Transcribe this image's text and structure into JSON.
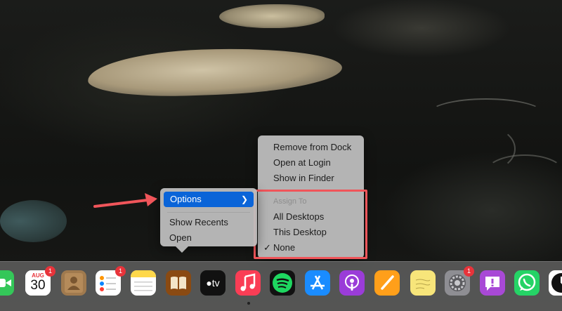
{
  "context_menu": {
    "items": [
      {
        "label": "Options"
      },
      {
        "label": "Show Recents"
      },
      {
        "label": "Open"
      }
    ],
    "highlight_color": "#0a64d8"
  },
  "options_submenu": {
    "items": [
      {
        "label": "Remove from Dock"
      },
      {
        "label": "Open at Login"
      },
      {
        "label": "Show in Finder"
      }
    ],
    "assign_to": {
      "header": "Assign To",
      "options": [
        {
          "label": "All Desktops",
          "checked": false
        },
        {
          "label": "This Desktop",
          "checked": false
        },
        {
          "label": "None",
          "checked": true
        }
      ]
    }
  },
  "annotation": {
    "box_color": "#f0555a",
    "arrow_color": "#f0555a"
  },
  "dock": {
    "apps": [
      {
        "name": "FaceTime",
        "icon": "facetime-icon"
      },
      {
        "name": "Calendar",
        "icon": "calendar-icon",
        "month": "AUG",
        "day": "30",
        "badge": "1"
      },
      {
        "name": "Contacts",
        "icon": "contacts-icon"
      },
      {
        "name": "Reminders",
        "icon": "reminders-icon",
        "badge": "1"
      },
      {
        "name": "Notes",
        "icon": "notes-icon"
      },
      {
        "name": "Books",
        "icon": "books-icon"
      },
      {
        "name": "Apple TV",
        "icon": "apple-tv-icon",
        "label": "tv"
      },
      {
        "name": "Music",
        "icon": "music-icon"
      },
      {
        "name": "Spotify",
        "icon": "spotify-icon"
      },
      {
        "name": "App Store",
        "icon": "app-store-icon"
      },
      {
        "name": "Podcasts",
        "icon": "podcasts-icon"
      },
      {
        "name": "Pages",
        "icon": "pages-icon"
      },
      {
        "name": "Stickies",
        "icon": "stickies-icon"
      },
      {
        "name": "System Preferences",
        "icon": "settings-gear-icon",
        "badge": "1"
      },
      {
        "name": "Feedback Assistant",
        "icon": "feedback-icon"
      },
      {
        "name": "WhatsApp",
        "icon": "whatsapp-icon"
      },
      {
        "name": "Clock",
        "icon": "clock-icon"
      }
    ]
  }
}
